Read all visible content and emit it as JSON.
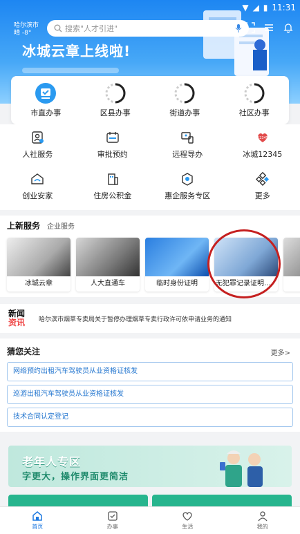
{
  "status_bar": {
    "time": "11:31"
  },
  "header": {
    "city": "哈尔滨市",
    "weather": "晴 -8°",
    "search_placeholder": "搜索\"人才引进\"",
    "slogan": "冰城云章上线啦!"
  },
  "top_services": [
    {
      "label": "市直办事",
      "icon": "government-icon"
    },
    {
      "label": "区县办事",
      "icon": "loading-icon"
    },
    {
      "label": "街道办事",
      "icon": "loading-icon"
    },
    {
      "label": "社区办事",
      "icon": "loading-icon"
    }
  ],
  "grid_services": [
    {
      "label": "人社服务",
      "icon": "person-card-icon"
    },
    {
      "label": "审批预约",
      "icon": "calendar-icon"
    },
    {
      "label": "远程导办",
      "icon": "remote-icon"
    },
    {
      "label": "冰城12345",
      "icon": "hotline-icon"
    },
    {
      "label": "创业安家",
      "icon": "home-icon"
    },
    {
      "label": "住房公积金",
      "icon": "building-icon"
    },
    {
      "label": "惠企服务专区",
      "icon": "enterprise-icon"
    },
    {
      "label": "更多",
      "icon": "more-icon"
    }
  ],
  "new_services": {
    "tab_active": "上新服务",
    "tab_other": "企业服务",
    "cards": [
      {
        "label": "冰城云章"
      },
      {
        "label": "人大直通车"
      },
      {
        "label": "临时身份证明"
      },
      {
        "label": "无犯罪记录证明专..."
      },
      {
        "label": ""
      }
    ]
  },
  "news": {
    "logo_line1": "新闻",
    "logo_line2": "资讯",
    "headline": "哈尔滨市烟草专卖局关于暂停办理烟草专卖行政许可依申请业务的通知"
  },
  "guess": {
    "title": "猜您关注",
    "more": "更多>",
    "items": [
      "网络预约出租汽车驾驶员从业资格证核发",
      "巡游出租汽车驾驶员从业资格证核发",
      "技术合同认定登记"
    ]
  },
  "elder_banner": {
    "title": "老年人专区",
    "subtitle": "字更大，操作界面更简洁"
  },
  "tabbar": [
    {
      "label": "首页",
      "icon": "home-icon",
      "active": true
    },
    {
      "label": "办事",
      "icon": "checkbox-icon",
      "active": false
    },
    {
      "label": "生活",
      "icon": "heart-icon",
      "active": false
    },
    {
      "label": "我的",
      "icon": "user-icon",
      "active": false
    }
  ],
  "colors": {
    "accent": "#1f7ae0",
    "banner_blue": "#1d86f2",
    "highlight_red": "#c52020",
    "green": "#27b58e"
  }
}
